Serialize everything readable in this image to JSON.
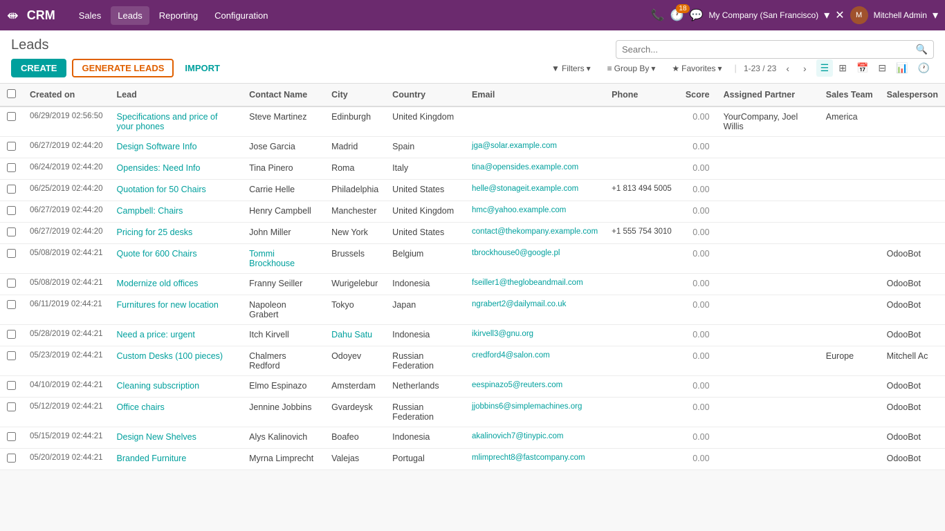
{
  "topnav": {
    "brand": "CRM",
    "nav_links": [
      "Sales",
      "Leads",
      "Reporting",
      "Configuration"
    ],
    "company": "My Company (San Francisco)",
    "user": "Mitchell Admin",
    "badge_count": "18"
  },
  "page": {
    "title": "Leads",
    "create_label": "CREATE",
    "generate_label": "GENERATE LEADS",
    "import_label": "IMPORT"
  },
  "search": {
    "placeholder": "Search..."
  },
  "filters": {
    "filters_label": "Filters",
    "group_by_label": "Group By",
    "favorites_label": "Favorites",
    "pagination": "1-23 / 23"
  },
  "table": {
    "columns": [
      "Created on",
      "Lead",
      "Contact Name",
      "City",
      "Country",
      "Email",
      "Phone",
      "Score",
      "Assigned Partner",
      "Sales Team",
      "Salesperson"
    ],
    "rows": [
      {
        "created_on": "06/29/2019 02:56:50",
        "lead": "Specifications and price of your phones",
        "contact_name": "Steve Martinez",
        "city": "Edinburgh",
        "country": "United Kingdom",
        "email": "",
        "phone": "",
        "score": "0.00",
        "assigned_partner": "YourCompany, Joel Willis",
        "sales_team": "America",
        "salesperson": ""
      },
      {
        "created_on": "06/27/2019 02:44:20",
        "lead": "Design Software Info",
        "contact_name": "Jose Garcia",
        "city": "Madrid",
        "country": "Spain",
        "email": "jga@solar.example.com",
        "phone": "",
        "score": "0.00",
        "assigned_partner": "",
        "sales_team": "",
        "salesperson": ""
      },
      {
        "created_on": "06/24/2019 02:44:20",
        "lead": "Opensides: Need Info",
        "contact_name": "Tina Pinero",
        "city": "Roma",
        "country": "Italy",
        "email": "tina@opensides.example.com",
        "phone": "",
        "score": "0.00",
        "assigned_partner": "",
        "sales_team": "",
        "salesperson": ""
      },
      {
        "created_on": "06/25/2019 02:44:20",
        "lead": "Quotation for 50 Chairs",
        "contact_name": "Carrie Helle",
        "city": "Philadelphia",
        "country": "United States",
        "email": "helle@stonageit.example.com",
        "phone": "+1 813 494 5005",
        "score": "0.00",
        "assigned_partner": "",
        "sales_team": "",
        "salesperson": ""
      },
      {
        "created_on": "06/27/2019 02:44:20",
        "lead": "Campbell: Chairs",
        "contact_name": "Henry Campbell",
        "city": "Manchester",
        "country": "United Kingdom",
        "email": "hmc@yahoo.example.com",
        "phone": "",
        "score": "0.00",
        "assigned_partner": "",
        "sales_team": "",
        "salesperson": ""
      },
      {
        "created_on": "06/27/2019 02:44:20",
        "lead": "Pricing for 25 desks",
        "contact_name": "John Miller",
        "city": "New York",
        "country": "United States",
        "email": "contact@thekompany.example.com",
        "phone": "+1 555 754 3010",
        "score": "0.00",
        "assigned_partner": "",
        "sales_team": "",
        "salesperson": ""
      },
      {
        "created_on": "05/08/2019 02:44:21",
        "lead": "Quote for 600 Chairs",
        "contact_name": "Tommi Brockhouse",
        "city": "Brussels",
        "country": "Belgium",
        "email": "tbrockhouse0@google.pl",
        "phone": "",
        "score": "0.00",
        "assigned_partner": "",
        "sales_team": "",
        "salesperson": "OdooBot"
      },
      {
        "created_on": "05/08/2019 02:44:21",
        "lead": "Modernize old offices",
        "contact_name": "Franny Seiller",
        "city": "Wurigelebur",
        "country": "Indonesia",
        "email": "fseiller1@theglobeandmail.com",
        "phone": "",
        "score": "0.00",
        "assigned_partner": "",
        "sales_team": "",
        "salesperson": "OdooBot"
      },
      {
        "created_on": "06/11/2019 02:44:21",
        "lead": "Furnitures for new location",
        "contact_name": "Napoleon Grabert",
        "city": "Tokyo",
        "country": "Japan",
        "email": "ngrabert2@dailymail.co.uk",
        "phone": "",
        "score": "0.00",
        "assigned_partner": "",
        "sales_team": "",
        "salesperson": "OdooBot"
      },
      {
        "created_on": "05/28/2019 02:44:21",
        "lead": "Need a price: urgent",
        "contact_name": "Itch Kirvell",
        "city": "Dahu Satu",
        "country": "Indonesia",
        "email": "ikirvell3@gnu.org",
        "phone": "",
        "score": "0.00",
        "assigned_partner": "",
        "sales_team": "",
        "salesperson": "OdooBot"
      },
      {
        "created_on": "05/23/2019 02:44:21",
        "lead": "Custom Desks (100 pieces)",
        "contact_name": "Chalmers Redford",
        "city": "Odoyev",
        "country": "Russian Federation",
        "email": "credford4@salon.com",
        "phone": "",
        "score": "0.00",
        "assigned_partner": "",
        "sales_team": "Europe",
        "salesperson": "Mitchell Ac"
      },
      {
        "created_on": "04/10/2019 02:44:21",
        "lead": "Cleaning subscription",
        "contact_name": "Elmo Espinazo",
        "city": "Amsterdam",
        "country": "Netherlands",
        "email": "eespinazo5@reuters.com",
        "phone": "",
        "score": "0.00",
        "assigned_partner": "",
        "sales_team": "",
        "salesperson": "OdooBot"
      },
      {
        "created_on": "05/12/2019 02:44:21",
        "lead": "Office chairs",
        "contact_name": "Jennine Jobbins",
        "city": "Gvardeysk",
        "country": "Russian Federation",
        "email": "jjobbins6@simplemachines.org",
        "phone": "",
        "score": "0.00",
        "assigned_partner": "",
        "sales_team": "",
        "salesperson": "OdooBot"
      },
      {
        "created_on": "05/15/2019 02:44:21",
        "lead": "Design New Shelves",
        "contact_name": "Alys Kalinovich",
        "city": "Boafeo",
        "country": "Indonesia",
        "email": "akalinovich7@tinypic.com",
        "phone": "",
        "score": "0.00",
        "assigned_partner": "",
        "sales_team": "",
        "salesperson": "OdooBot"
      },
      {
        "created_on": "05/20/2019 02:44:21",
        "lead": "Branded Furniture",
        "contact_name": "Myrna Limprecht",
        "city": "Valejas",
        "country": "Portugal",
        "email": "mlimprecht8@fastcompany.com",
        "phone": "",
        "score": "0.00",
        "assigned_partner": "",
        "sales_team": "",
        "salesperson": "OdooBot"
      }
    ]
  }
}
